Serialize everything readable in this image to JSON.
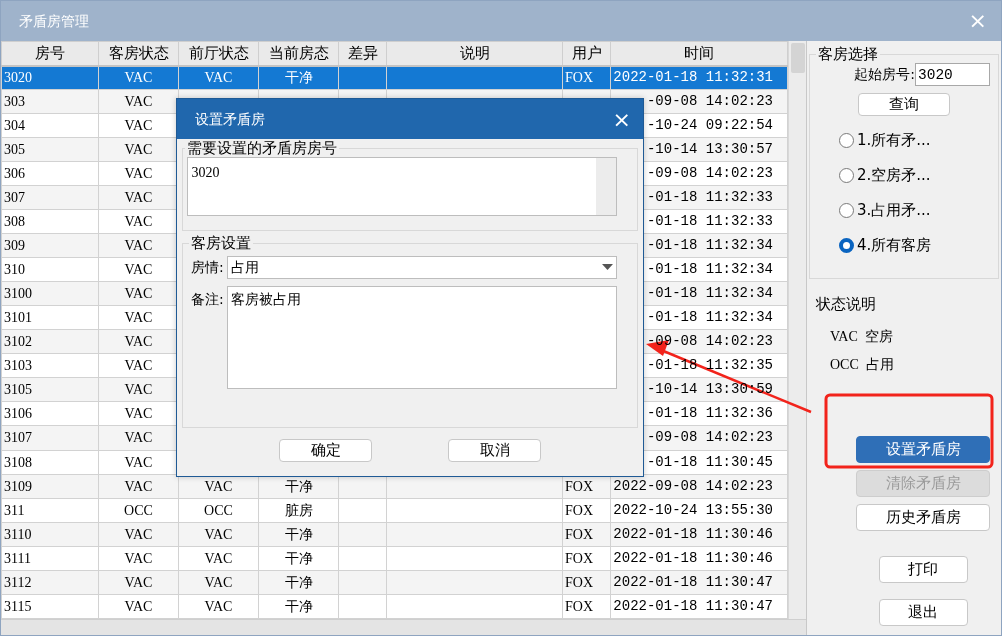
{
  "window": {
    "title": "矛盾房管理",
    "close": "×"
  },
  "table": {
    "columns": [
      "房号",
      "客房状态",
      "前厅状态",
      "当前房态",
      "差异",
      "说明",
      "用户",
      "时间"
    ],
    "rows": [
      {
        "room": "3020",
        "guest_status": "VAC",
        "desk_status": "VAC",
        "room_state": "干净",
        "user": "FOX",
        "time": "2022-01-18 11:32:31",
        "selected": true
      },
      {
        "room": "303",
        "guest_status": "VAC",
        "time": "-09-08 14:02:23",
        "selected": false
      },
      {
        "room": "304",
        "guest_status": "VAC",
        "time": "-10-24 09:22:54",
        "selected": false
      },
      {
        "room": "305",
        "guest_status": "VAC",
        "time": "-10-14 13:30:57",
        "selected": false
      },
      {
        "room": "306",
        "guest_status": "VAC",
        "time": "-09-08 14:02:23",
        "selected": false
      },
      {
        "room": "307",
        "guest_status": "VAC",
        "time": "-01-18 11:32:33",
        "selected": false
      },
      {
        "room": "308",
        "guest_status": "VAC",
        "time": "-01-18 11:32:33",
        "selected": false
      },
      {
        "room": "309",
        "guest_status": "VAC",
        "time": "-01-18 11:32:34",
        "selected": false
      },
      {
        "room": "310",
        "guest_status": "VAC",
        "time": "-01-18 11:32:34",
        "selected": false
      },
      {
        "room": "3100",
        "guest_status": "VAC",
        "time": "-01-18 11:32:34",
        "selected": false
      },
      {
        "room": "3101",
        "guest_status": "VAC",
        "time": "-01-18 11:32:34",
        "selected": false
      },
      {
        "room": "3102",
        "guest_status": "VAC",
        "time": "-09-08 14:02:23",
        "selected": false
      },
      {
        "room": "3103",
        "guest_status": "VAC",
        "time": "-01-18 11:32:35",
        "selected": false
      },
      {
        "room": "3105",
        "guest_status": "VAC",
        "time": "-10-14 13:30:59",
        "selected": false
      },
      {
        "room": "3106",
        "guest_status": "VAC",
        "time": "-01-18 11:32:36",
        "selected": false
      },
      {
        "room": "3107",
        "guest_status": "VAC",
        "time": "-09-08 14:02:23",
        "selected": false
      },
      {
        "room": "3108",
        "guest_status": "VAC",
        "time": "-01-18 11:30:45",
        "selected": false
      },
      {
        "room": "3109",
        "guest_status": "VAC",
        "desk_status": "VAC",
        "room_state": "干净",
        "user": "FOX",
        "time": "2022-09-08 14:02:23",
        "selected": false
      },
      {
        "room": "311",
        "guest_status": "OCC",
        "desk_status": "OCC",
        "room_state": "脏房",
        "user": "FOX",
        "time": "2022-10-24 13:55:30",
        "selected": false
      },
      {
        "room": "3110",
        "guest_status": "VAC",
        "desk_status": "VAC",
        "room_state": "干净",
        "user": "FOX",
        "time": "2022-01-18 11:30:46",
        "selected": false
      },
      {
        "room": "3111",
        "guest_status": "VAC",
        "desk_status": "VAC",
        "room_state": "干净",
        "user": "FOX",
        "time": "2022-01-18 11:30:46",
        "selected": false
      },
      {
        "room": "3112",
        "guest_status": "VAC",
        "desk_status": "VAC",
        "room_state": "干净",
        "user": "FOX",
        "time": "2022-01-18 11:30:47",
        "selected": false
      },
      {
        "room": "3115",
        "guest_status": "VAC",
        "desk_status": "VAC",
        "room_state": "干净",
        "user": "FOX",
        "time": "2022-01-18 11:30:47",
        "selected": false
      }
    ]
  },
  "room_selection": {
    "title": "客房选择",
    "start_label": "起始房号:",
    "start_value": "3020",
    "query_button": "查询",
    "options": [
      {
        "label": "1.所有矛...",
        "selected": false
      },
      {
        "label": "2.空房矛...",
        "selected": false
      },
      {
        "label": "3.占用矛...",
        "selected": false
      },
      {
        "label": "4.所有客房",
        "selected": true
      }
    ]
  },
  "legend": {
    "title": "状态说明",
    "items": [
      {
        "code": "VAC",
        "meaning": "空房"
      },
      {
        "code": "OCC",
        "meaning": "占用"
      }
    ]
  },
  "action_buttons": [
    {
      "label": "设置矛盾房",
      "kind": "primary",
      "disabled": false
    },
    {
      "label": "清除矛盾房",
      "kind": "normal",
      "disabled": true
    },
    {
      "label": "历史矛盾房",
      "kind": "normal",
      "disabled": false
    }
  ],
  "footer_buttons": [
    {
      "label": "打印"
    },
    {
      "label": "退出"
    }
  ],
  "dialog": {
    "title": "设置矛盾房",
    "close": "×",
    "room_group": {
      "title": "需要设置的矛盾房房号",
      "value": "3020"
    },
    "guest_group": {
      "title": "客房设置",
      "condition_label": "房情:",
      "condition_value": "占用",
      "note_label": "备注:",
      "note_value": "客房被占用"
    },
    "buttons": [
      "确定",
      "取消"
    ]
  }
}
